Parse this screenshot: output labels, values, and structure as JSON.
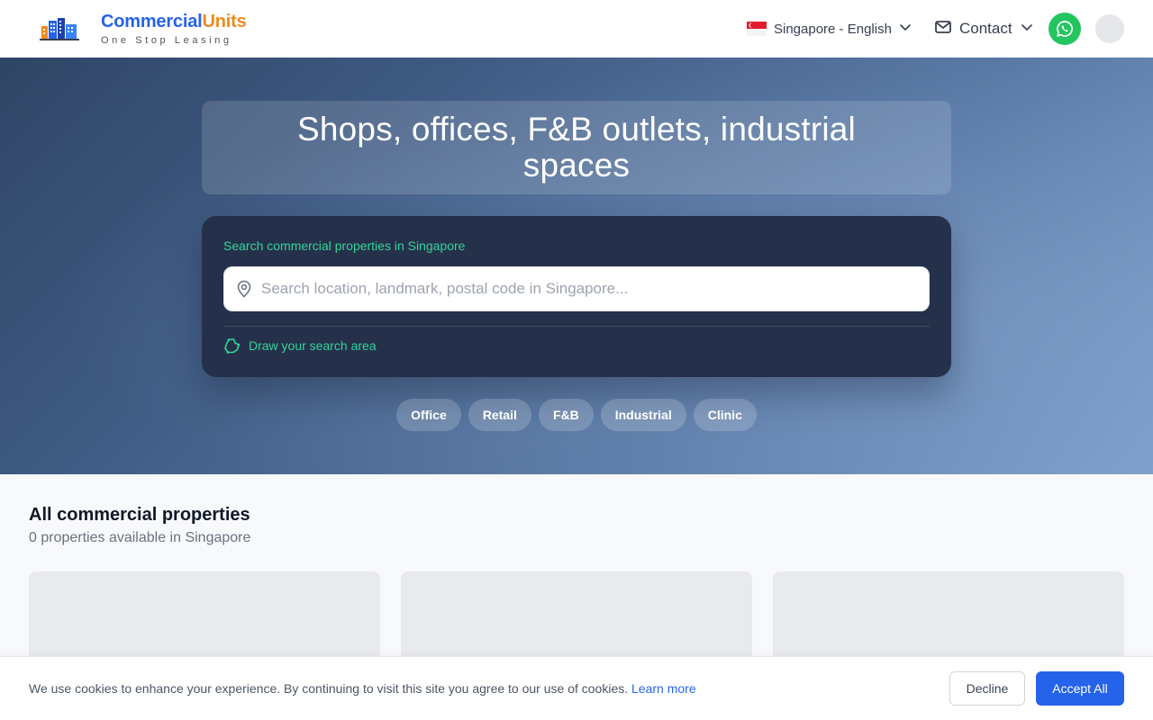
{
  "brand": {
    "name_part1": "Commercial",
    "name_part2": "Units",
    "tagline": "One Stop Leasing",
    "logo_icon": "buildings-logo-icon"
  },
  "header": {
    "language_label": "Singapore - English",
    "flag_icon": "singapore-flag-icon",
    "contact_label": "Contact",
    "whatsapp_icon": "whatsapp-icon"
  },
  "hero": {
    "headline": "Shops, offices, F&B outlets, industrial spaces",
    "search_label": "Search commercial properties in Singapore",
    "search_placeholder": "Search location, landmark, postal code in Singapore...",
    "search_value": "",
    "draw_label": "Draw your search area",
    "categories": [
      "Office",
      "Retail",
      "F&B",
      "Industrial",
      "Clinic"
    ]
  },
  "listings": {
    "title": "All commercial properties",
    "subtitle": "0 properties available in Singapore"
  },
  "cookie": {
    "message": "We use cookies to enhance your experience. By continuing to visit this site you agree to our use of cookies.",
    "link": "Learn more",
    "decline": "Decline",
    "accept": "Accept All"
  },
  "colors": {
    "brand_blue": "#2563eb",
    "brand_orange": "#f08a1c",
    "accent_green": "#34d399",
    "whatsapp_green": "#22c55e",
    "search_card_bg": "#25314a"
  }
}
